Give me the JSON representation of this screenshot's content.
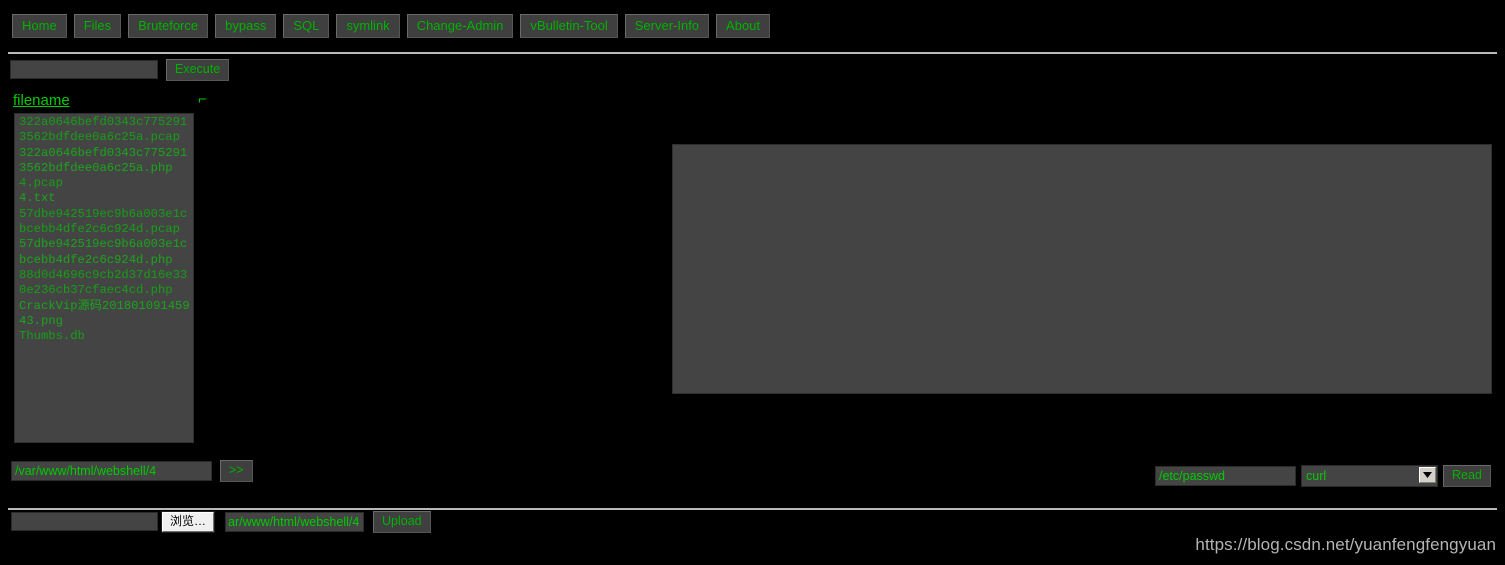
{
  "nav": {
    "items": [
      {
        "label": "Home"
      },
      {
        "label": "Files"
      },
      {
        "label": "Bruteforce"
      },
      {
        "label": "bypass"
      },
      {
        "label": "SQL"
      },
      {
        "label": "symlink"
      },
      {
        "label": "Change-Admin"
      },
      {
        "label": "vBulletin-Tool"
      },
      {
        "label": "Server-Info"
      },
      {
        "label": "About"
      }
    ]
  },
  "command": {
    "value": "",
    "placeholder": "",
    "execute_label": "Execute"
  },
  "file_panel": {
    "header_label": "filename",
    "caret_mark": "⌐",
    "files": [
      "322a0646befd0343c7752913562bdfdee0a6c25a.pcap",
      "322a0646befd0343c7752913562bdfdee0a6c25a.php",
      "4.pcap",
      "4.txt",
      "57dbe942519ec9b6a003e1cbcebb4dfe2c6c924d.pcap",
      "57dbe942519ec9b6a003e1cbcebb4dfe2c6c924d.php",
      "88d0d4696c9cb2d37d16e330e236cb37cfaec4cd.php",
      "CrackVip源码20180109145943.png",
      "Thumbs.db"
    ]
  },
  "output": {
    "value": "",
    "placeholder": ""
  },
  "path_row": {
    "value": "/var/www/html/webshell/4",
    "placeholder": "",
    "go_label": ">>"
  },
  "read_row": {
    "file_value": "/etc/passwd",
    "file_placeholder": "",
    "function_selected": "curl",
    "function_options": [
      "curl"
    ],
    "read_label": "Read"
  },
  "upload_row": {
    "file_input_value": "",
    "browse_label": "浏览…",
    "dest_value": "ar/www/html/webshell/4",
    "dest_placeholder": "",
    "upload_label": "Upload"
  },
  "watermark": {
    "text": "https://blog.csdn.net/yuanfengfengyuan"
  },
  "colors": {
    "background": "#000000",
    "accent_green": "#00cc00",
    "control_bg": "#444444",
    "button_bg": "#3f3f3f",
    "rule": "#b9b9b9",
    "watermark": "#b5b5b5"
  }
}
